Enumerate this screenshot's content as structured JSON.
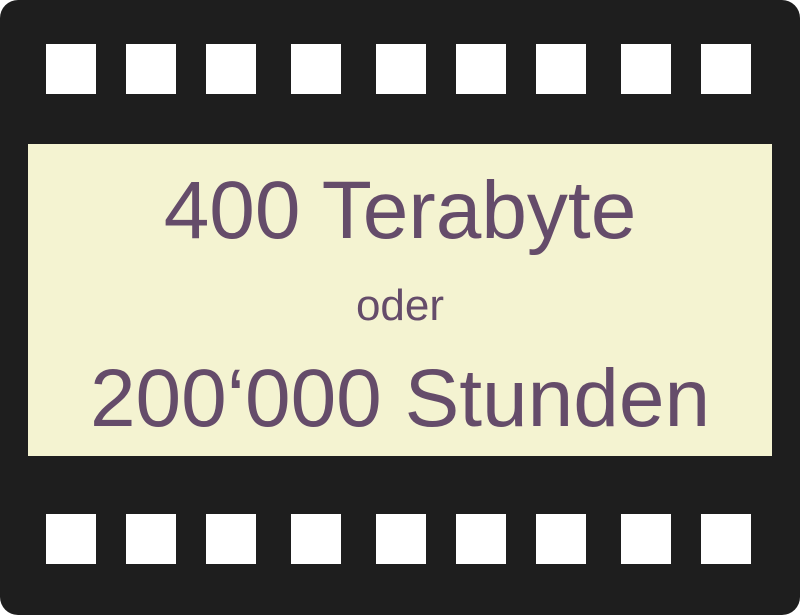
{
  "colors": {
    "film": "#1e1e1e",
    "perforation": "#ffffff",
    "frame": "#f4f3d1",
    "text": "#654c6a"
  },
  "perforations_per_row": 9,
  "frame_text": {
    "line1": "400 Terabyte",
    "line2": "oder",
    "line3": "200‘000 Stunden"
  }
}
